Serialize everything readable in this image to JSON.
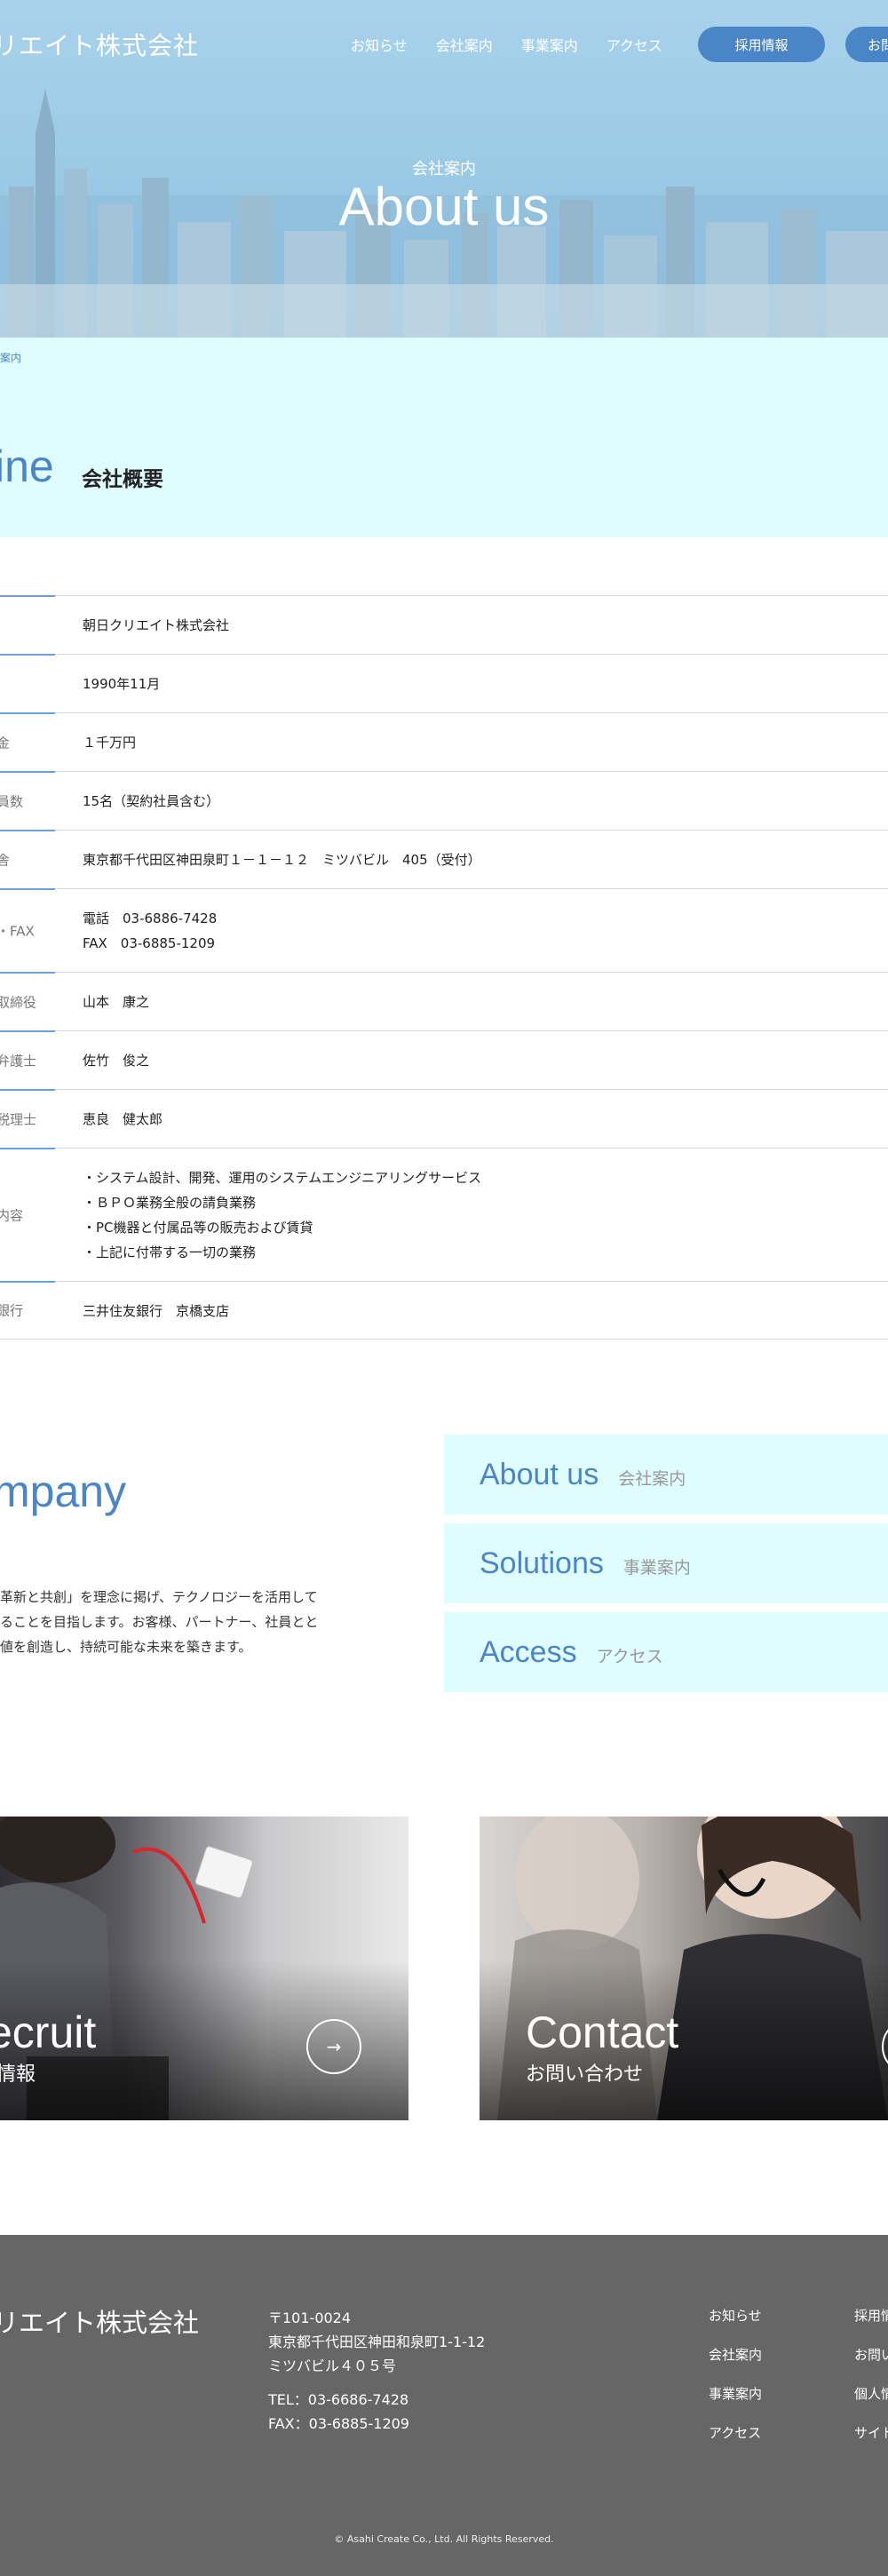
{
  "header": {
    "logo": "リエイト株式会社",
    "nav": [
      "お知らせ",
      "会社案内",
      "事業案内",
      "アクセス"
    ],
    "recruit_button": "採用情報",
    "contact_button": "お問"
  },
  "hero": {
    "subtitle": "会社案内",
    "title": "About us"
  },
  "breadcrumb": "案内",
  "outline": {
    "title_en": "ine",
    "title_ja": "会社概要"
  },
  "table": {
    "rows": [
      {
        "label": "",
        "value": "朝日クリエイト株式会社"
      },
      {
        "label": "",
        "value": "1990年11月"
      },
      {
        "label": "金",
        "value": "１千万円"
      },
      {
        "label": "員数",
        "value": "15名（契約社員含む）"
      },
      {
        "label": "舎",
        "value": "東京都千代田区神田泉町１－１－１２　ミツバビル　405（受付）"
      },
      {
        "label": "・FAX",
        "value": "電話　03-6886-7428\nFAX　03-6885-1209"
      },
      {
        "label": "取締役",
        "value": "山本　康之"
      },
      {
        "label": "弁護士",
        "value": "佐竹　俊之"
      },
      {
        "label": "税理士",
        "value": "恵良　健太郎"
      },
      {
        "label": "内容",
        "value": "・システム設計、開発、運用のシステムエンジニアリングサービス\n・ＢＰＯ業務全般の請負業務\n・PC機器と付属品等の販売および賃貸\n・上記に付帯する一切の業務"
      },
      {
        "label": "銀行",
        "value": "三井住友銀行　京橋支店"
      }
    ]
  },
  "company": {
    "title": "mpany",
    "text": "革新と共創」を理念に掲げ、テクノロジーを活用して\nることを目指します。お客様、パートナー、社員とと\n値を創造し、持続可能な未来を築きます。"
  },
  "cards": [
    {
      "en": "About us",
      "ja": "会社案内"
    },
    {
      "en": "Solutions",
      "ja": "事業案内"
    },
    {
      "en": "Access",
      "ja": "アクセス"
    }
  ],
  "tiles": {
    "recruit": {
      "en": "ecruit",
      "ja": "情報",
      "arrow": "→"
    },
    "contact": {
      "en": "Contact",
      "ja": "お問い合わせ"
    }
  },
  "footer": {
    "logo": "リエイト株式会社",
    "address": [
      "〒101-0024",
      "東京都千代田区神田和泉町1-1-12",
      "ミツバビル４０５号"
    ],
    "tel": "TEL：03-6686-7428",
    "fax": "FAX：03-6885-1209",
    "links_col1": [
      "お知らせ",
      "会社案内",
      "事業案内",
      "アクセス"
    ],
    "links_col2": [
      "採用情",
      "お問い",
      "個人情",
      "サイト"
    ],
    "copyright": "© Asahi Create Co., Ltd. All Rights Reserved."
  }
}
